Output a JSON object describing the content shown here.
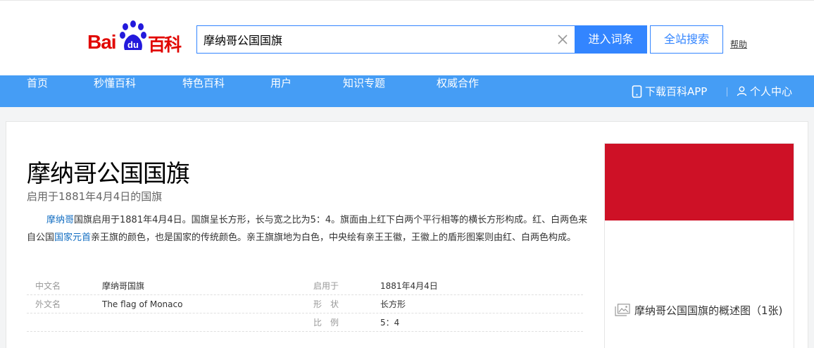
{
  "header": {
    "logo": {
      "bai": "Bai",
      "du": "du",
      "baike": "百科"
    },
    "search": {
      "value": "摩纳哥公国国旗",
      "placeholder": ""
    },
    "enter_button": "进入词条",
    "site_search_button": "全站搜索",
    "help_link": "帮助"
  },
  "nav": {
    "items": [
      {
        "label": "首页"
      },
      {
        "label": "秒懂百科"
      },
      {
        "label": "特色百科"
      },
      {
        "label": "用户"
      },
      {
        "label": "知识专题"
      },
      {
        "label": "权威合作"
      }
    ],
    "download_app": "下载百科APP",
    "personal_center": "个人中心"
  },
  "article": {
    "title": "摩纳哥公国国旗",
    "subtitle": "启用于1881年4月4日的国旗",
    "summary": {
      "link1": "摩纳哥",
      "text1": "国旗启用于1881年4月4日。国旗呈长方形，长与宽之比为5：4。旗面由上红下白两个平行相等的横长方形构成。红、白两色来自公国",
      "link2": "国家元首",
      "text2": "亲王旗的颜色，也是国家的传统颜色。亲王旗旗地为白色，中央绘有亲王王徽，王徽上的盾形图案则由红、白两色构成。"
    },
    "info": [
      {
        "k1": "中文名",
        "v1": "摩纳哥国旗",
        "k2": "启用于",
        "v2": "1881年4月4日"
      },
      {
        "k1": "外文名",
        "v1": "The flag of Monaco",
        "k2": "形　状",
        "v2": "长方形"
      },
      {
        "k1": "",
        "v1": "",
        "k2": "比　例",
        "v2": "5：4"
      }
    ],
    "image_caption": "摩纳哥公国国旗的概述图（1张)"
  },
  "colors": {
    "brand_red": "#e10601",
    "brand_blue": "#3385ff",
    "nav_blue": "#459df5",
    "link_blue": "#136ec2",
    "flag_red": "#ce1126",
    "flag_white": "#ffffff"
  },
  "icons": {
    "logo_paw": "paw-icon",
    "clear": "close-icon",
    "phone": "phone-icon",
    "user": "user-icon",
    "image": "image-icon"
  }
}
